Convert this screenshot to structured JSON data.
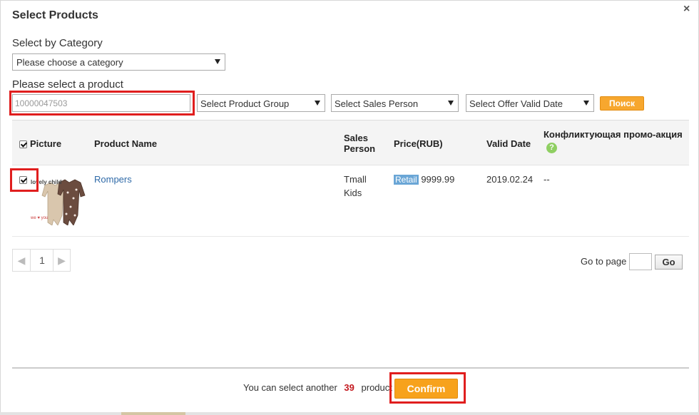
{
  "dialog": {
    "title": "Select Products",
    "close_glyph": "×"
  },
  "category": {
    "label": "Select by Category",
    "placeholder": "Please choose a category"
  },
  "product": {
    "label": "Please select a product",
    "input_value": "10000047503",
    "group_select": "Select Product Group",
    "sales_person_select": "Select Sales Person",
    "valid_date_select": "Select Offer Valid Date",
    "search_label": "Поиск"
  },
  "table": {
    "headers": {
      "picture": "Picture",
      "product_name": "Product Name",
      "sales_person_1": "Sales",
      "sales_person_2": "Person",
      "price": "Price(RUB)",
      "valid_date": "Valid Date",
      "conflict": "Конфликтующая промо-акция",
      "help_icon": "?"
    },
    "rows": [
      {
        "checked": true,
        "product_name": "Rompers",
        "image_brand": "lovely child",
        "image_caption": "we ♥ you",
        "sales_person_1": "Tmall",
        "sales_person_2": "Kids",
        "price_badge": "Retail",
        "price": "9999.99",
        "valid_date": "2019.02.24",
        "conflict": "--"
      }
    ]
  },
  "pagination": {
    "current_page": "1",
    "goto_label": "Go to page",
    "go_label": "Go"
  },
  "footer": {
    "prefix": "You can select another",
    "count": "39",
    "suffix": "product",
    "confirm_label": "Confirm"
  },
  "colors": {
    "accent": "#f7a21c",
    "highlight_box": "#e01e1e",
    "link": "#2f6aa8",
    "badge": "#6aa6d6",
    "count": "#c4191f"
  }
}
